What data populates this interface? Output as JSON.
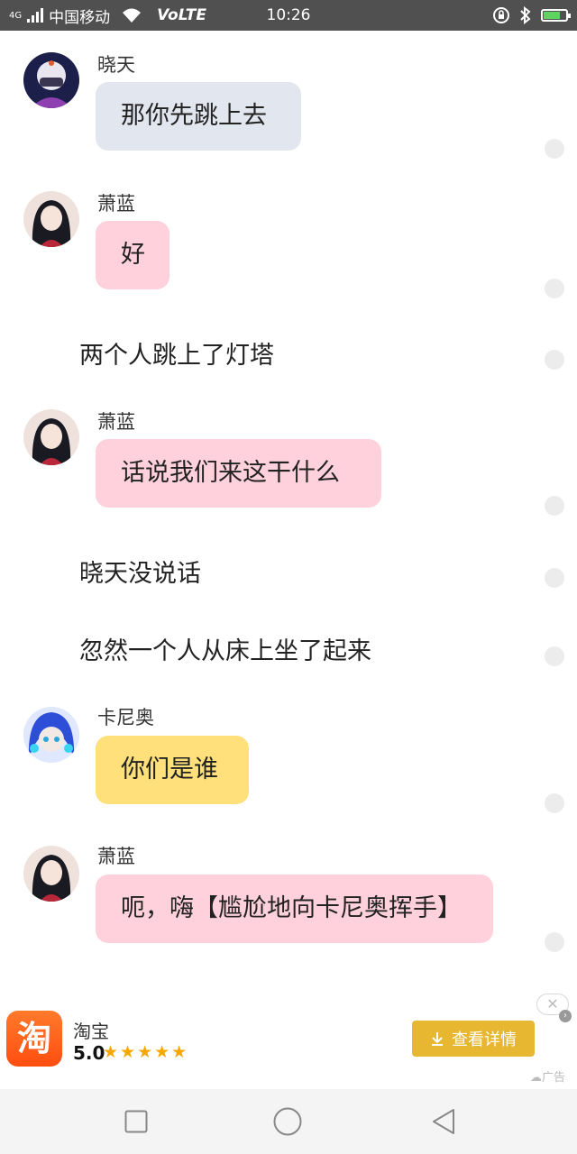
{
  "status_bar": {
    "network_type": "4G",
    "carrier": "中国移动",
    "volte": "VoLTE",
    "time": "10:26"
  },
  "messages": [
    {
      "kind": "dialogue",
      "sender": "晓天",
      "text": "那你先跳上去",
      "bubble_color": "#e2e7ef",
      "avatar": "masked-boy-avatar"
    },
    {
      "kind": "dialogue",
      "sender": "萧蓝",
      "text": "好",
      "bubble_color": "#ffd1dc",
      "avatar": "dark-hair-girl-avatar"
    },
    {
      "kind": "narration",
      "text": "两个人跳上了灯塔"
    },
    {
      "kind": "dialogue",
      "sender": "萧蓝",
      "text": "话说我们来这干什么",
      "bubble_color": "#ffd1dc",
      "avatar": "dark-hair-girl-avatar"
    },
    {
      "kind": "narration",
      "text": "晓天没说话"
    },
    {
      "kind": "narration",
      "text": "忽然一个人从床上坐了起来"
    },
    {
      "kind": "dialogue",
      "sender": "卡尼奥",
      "text": "你们是谁",
      "bubble_color": "#ffe07a",
      "avatar": "blue-hair-boy-avatar"
    },
    {
      "kind": "dialogue",
      "sender": "萧蓝",
      "text": "呃，嗨【尴尬地向卡尼奥挥手】",
      "bubble_color": "#ffd1dc",
      "avatar": "dark-hair-girl-avatar"
    }
  ],
  "ad": {
    "app_icon_text": "淘",
    "app_name": "淘宝",
    "rating": "5.0",
    "stars": "★★★★★",
    "cta_label": "查看详情",
    "ad_tag": "广告",
    "close_symbol": "✕"
  },
  "colors": {
    "status_bar_bg": "#505050",
    "accent_cta": "#e7b732",
    "battery_green": "#5fd35f"
  }
}
